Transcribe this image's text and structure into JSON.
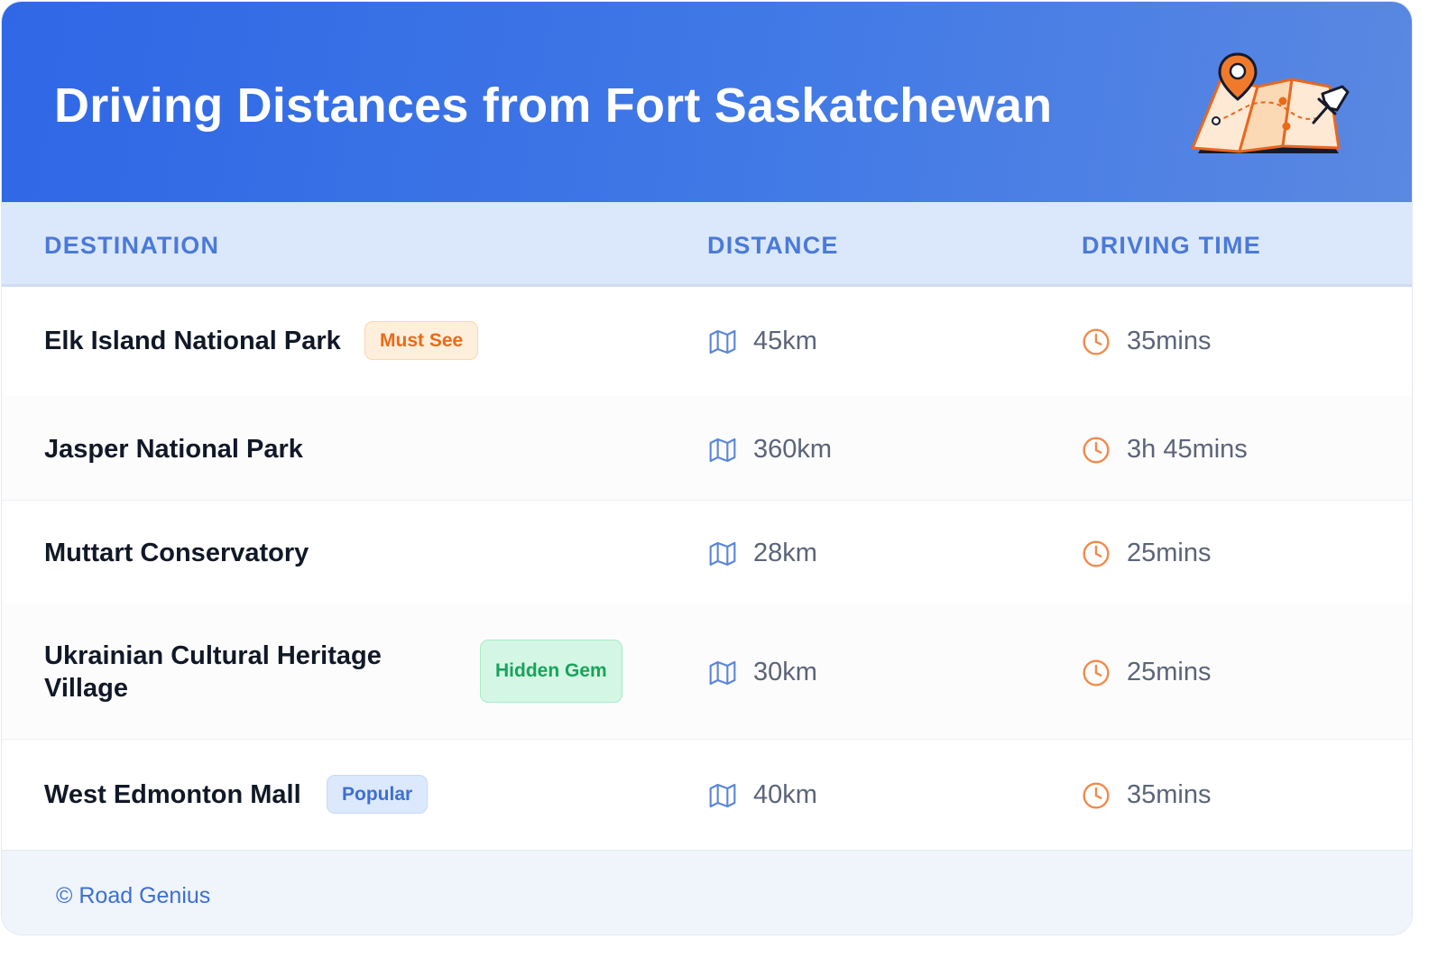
{
  "header": {
    "title": "Driving Distances from Fort Saskatchewan",
    "illustration_icon": "map-pin-illustration"
  },
  "table": {
    "columns": [
      "DESTINATION",
      "DISTANCE",
      "DRIVING TIME"
    ],
    "rows": [
      {
        "destination": "Elk Island National Park",
        "badge": "Must See",
        "distance": "45km",
        "time": "35mins"
      },
      {
        "destination": "Jasper National Park",
        "badge": "",
        "distance": "360km",
        "time": "3h 45mins"
      },
      {
        "destination": "Muttart Conservatory",
        "badge": "",
        "distance": "28km",
        "time": "25mins"
      },
      {
        "destination": "Ukrainian Cultural Heritage Village",
        "badge": "Hidden Gem",
        "distance": "30km",
        "time": "25mins"
      },
      {
        "destination": "West Edmonton Mall",
        "badge": "Popular",
        "distance": "40km",
        "time": "35mins"
      }
    ]
  },
  "footer": {
    "text": "© Road Genius"
  },
  "colors": {
    "header_gradient_start": "#2f67e6",
    "header_gradient_end": "#5a88e2",
    "table_header_bg": "#dbe8fb",
    "column_header_text": "#4a7ad8",
    "must_see_badge": "#ea6a18",
    "hidden_gem_badge": "#17a45a",
    "popular_badge": "#3c6fd6",
    "distance_icon": "#5b86d8",
    "time_icon": "#f08a4b"
  },
  "icons": {
    "distance": "map-icon",
    "time": "clock-icon"
  }
}
